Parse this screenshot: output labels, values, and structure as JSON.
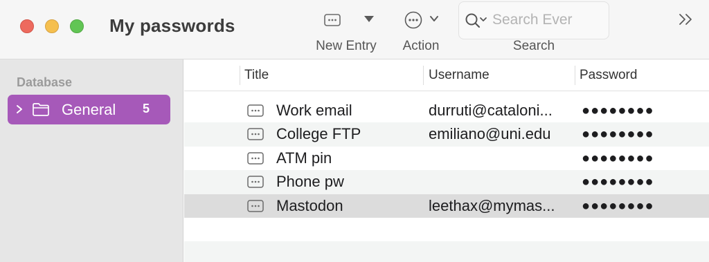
{
  "window": {
    "title": "My passwords"
  },
  "toolbar": {
    "new_entry_label": "New Entry",
    "action_label": "Action",
    "search_label": "Search",
    "search_placeholder": "Search Ever",
    "icons": {
      "new_entry": "entry-card-icon",
      "action": "ellipsis-circle-icon",
      "search": "magnifier-icon",
      "overflow": "double-chevron-right-icon"
    }
  },
  "sidebar": {
    "heading": "Database",
    "items": [
      {
        "label": "General",
        "count": "5",
        "icon": "folder-icon",
        "selected": true
      }
    ],
    "colors": {
      "selected_bg": "#a659b9"
    }
  },
  "table": {
    "columns": [
      "Title",
      "Username",
      "Password"
    ],
    "rows": [
      {
        "title": "Work email",
        "username": "durruti@cataloni...",
        "password": "●●●●●●●●"
      },
      {
        "title": "College FTP",
        "username": "emiliano@uni.edu",
        "password": "●●●●●●●●"
      },
      {
        "title": "ATM pin",
        "username": "",
        "password": "●●●●●●●●"
      },
      {
        "title": "Phone pw",
        "username": "",
        "password": "●●●●●●●●"
      },
      {
        "title": "Mastodon",
        "username": "leethax@mymas...",
        "password": "●●●●●●●●",
        "selected": true
      }
    ]
  }
}
